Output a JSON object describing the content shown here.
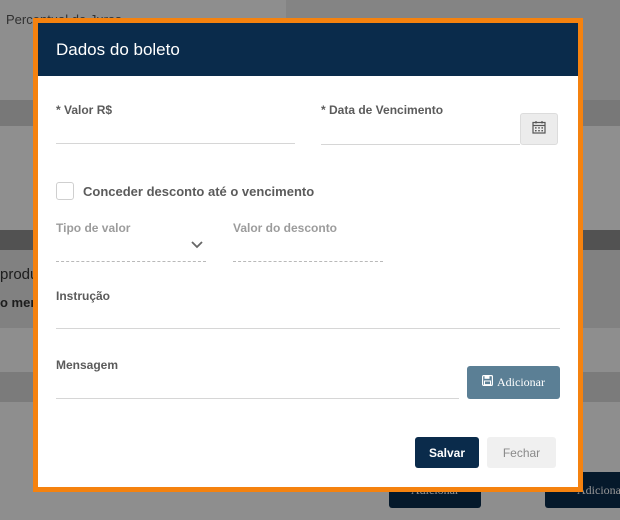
{
  "background": {
    "field_label_juros": "Percentual de Juros",
    "section_title_partial": "produ",
    "section_text_partial": "o meno",
    "button_adicionar_1": "Adicionar",
    "button_adicionar_2": "Adiciona"
  },
  "modal": {
    "title": "Dados do boleto",
    "valor_label": "* Valor R$",
    "data_vencimento_label": "* Data de Vencimento",
    "calendar_icon": "calendar-icon",
    "desconto_checkbox_label": "Conceder desconto até o vencimento",
    "tipo_valor_label": "Tipo de valor",
    "valor_desconto_label": "Valor do desconto",
    "instrucao_label": "Instrução",
    "mensagem_label": "Mensagem",
    "adicionar_button": "Adicionar",
    "salvar_button": "Salvar",
    "fechar_button": "Fechar"
  },
  "colors": {
    "header": "#0a2b4b",
    "highlight_border": "#f5820f",
    "adicionar_button": "#5b7f95",
    "salvar_button": "#0a2b4b"
  }
}
